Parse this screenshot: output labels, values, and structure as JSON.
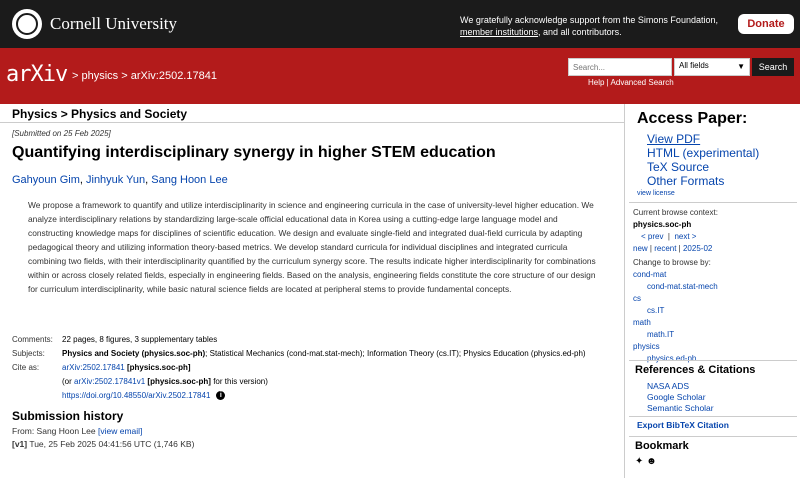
{
  "header": {
    "university": "Cornell University",
    "ack_pre": "We gratefully acknowledge support from the Simons Foundation, ",
    "ack_link": "member institutions",
    "ack_post": ", and all contributors.",
    "donate_label": "Donate"
  },
  "bar": {
    "logo": "arXiv",
    "crumb1": "physics",
    "crumb2": "arXiv:2502.17841",
    "search_placeholder": "Search...",
    "field_select": "All fields",
    "search_button": "Search",
    "help": "Help",
    "advanced": "Advanced Search"
  },
  "main": {
    "category": "Physics > Physics and Society",
    "submitted": "[Submitted on 25 Feb 2025]",
    "title": "Quantifying interdisciplinary synergy in higher STEM education",
    "authors": [
      "Gahyoun Gim",
      "Jinhyuk Yun",
      "Sang Hoon Lee"
    ],
    "abstract": "We propose a framework to quantify and utilize interdisciplinarity in science and engineering curricula in the case of university-level higher education. We analyze interdisciplinary relations by standardizing large-scale official educational data in Korea using a cutting-edge large language model and constructing knowledge maps for disciplines of scientific education. We design and evaluate single-field and integrated dual-field curricula by adapting pedagogical theory and utilizing information theory-based metrics. We develop standard curricula for individual disciplines and integrated curricula combining two fields, with their interdisciplinarity quantified by the curriculum synergy score. The results indicate higher interdisciplinarity for combinations within or across closely related fields, especially in engineering fields. Based on the analysis, engineering fields constitute the core structure of our design for curriculum interdisciplinarity, while basic natural science fields are located at peripheral stems to provide fundamental concepts.",
    "comments_label": "Comments:",
    "comments": "22 pages, 8 figures, 3 supplementary tables",
    "subjects_label": "Subjects:",
    "subjects_primary": "Physics and Society (physics.soc-ph)",
    "subjects_rest": "; Statistical Mechanics (cond-mat.stat-mech); Information Theory (cs.IT); Physics Education (physics.ed-ph)",
    "cite_label": "Cite as:",
    "cite_id": "arXiv:2502.17841",
    "cite_cat": "[physics.soc-ph]",
    "cite_or": "(or ",
    "cite_v1": "arXiv:2502.17841v1",
    "cite_cat2": "[physics.soc-ph]",
    "cite_suffix": " for this version)",
    "doi": "https://doi.org/10.48550/arXiv.2502.17841",
    "submission_history": "Submission history",
    "from_label": "From: Sang Hoon Lee ",
    "view_email": "[view email]",
    "v1_tag": "[v1]",
    "v1_text": " Tue, 25 Feb 2025 04:41:56 UTC (1,746 KB)"
  },
  "side": {
    "access": "Access Paper:",
    "links": [
      "View PDF",
      "HTML (experimental)",
      "TeX Source",
      "Other Formats"
    ],
    "view_license": "view license",
    "ctx_label": "Current browse context:",
    "ctx_value": "physics.soc-ph",
    "prev": "< prev",
    "next": "next >",
    "new": "new",
    "recent": "recent",
    "month": "2025-02",
    "change_label": "Change to browse by:",
    "browse": [
      {
        "text": "cond-mat",
        "indent": false
      },
      {
        "text": "cond-mat.stat-mech",
        "indent": true
      },
      {
        "text": "cs",
        "indent": false
      },
      {
        "text": "cs.IT",
        "indent": true
      },
      {
        "text": "math",
        "indent": false
      },
      {
        "text": "math.IT",
        "indent": true
      },
      {
        "text": "physics",
        "indent": false
      },
      {
        "text": "physics.ed-ph",
        "indent": true
      }
    ],
    "refs_heading": "References & Citations",
    "refs": [
      "NASA ADS",
      "Google Scholar",
      "Semantic Scholar"
    ],
    "bibtex": "Export BibTeX Citation",
    "bookmark": "Bookmark"
  }
}
